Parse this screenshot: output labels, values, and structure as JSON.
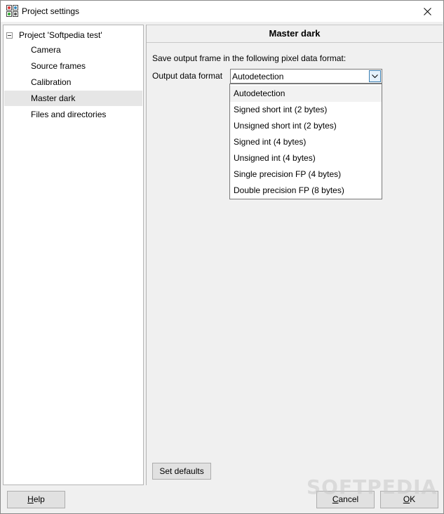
{
  "window": {
    "title": "Project settings",
    "icon": "app-icon",
    "close_icon": "close-icon"
  },
  "tree": {
    "root_label": "Project 'Softpedia test'",
    "items": [
      {
        "label": "Camera",
        "selected": false
      },
      {
        "label": "Source frames",
        "selected": false
      },
      {
        "label": "Calibration",
        "selected": false
      },
      {
        "label": "Master dark",
        "selected": true
      },
      {
        "label": "Files and directories",
        "selected": false
      }
    ]
  },
  "panel": {
    "header": "Master dark",
    "info_text": "Save output frame in the following pixel data format:",
    "format_label": "Output data format",
    "format_value": "Autodetection",
    "options": [
      "Autodetection",
      "Signed short int (2 bytes)",
      "Unsigned short int (2 bytes)",
      "Signed int (4 bytes)",
      "Unsigned int (4 bytes)",
      "Single precision FP (4 bytes)",
      "Double precision FP (8 bytes)"
    ],
    "set_defaults_label": "Set defaults"
  },
  "buttons": {
    "help_access": "H",
    "help_rest": "elp",
    "cancel_access": "C",
    "cancel_rest": "ancel",
    "ok_access": "O",
    "ok_rest": "K"
  },
  "watermark": "SOFTPEDIA",
  "colors": {
    "selection": "#e6e6e6",
    "highlight": "#f2f2f2",
    "combo_button_border": "#3c7fb1"
  }
}
